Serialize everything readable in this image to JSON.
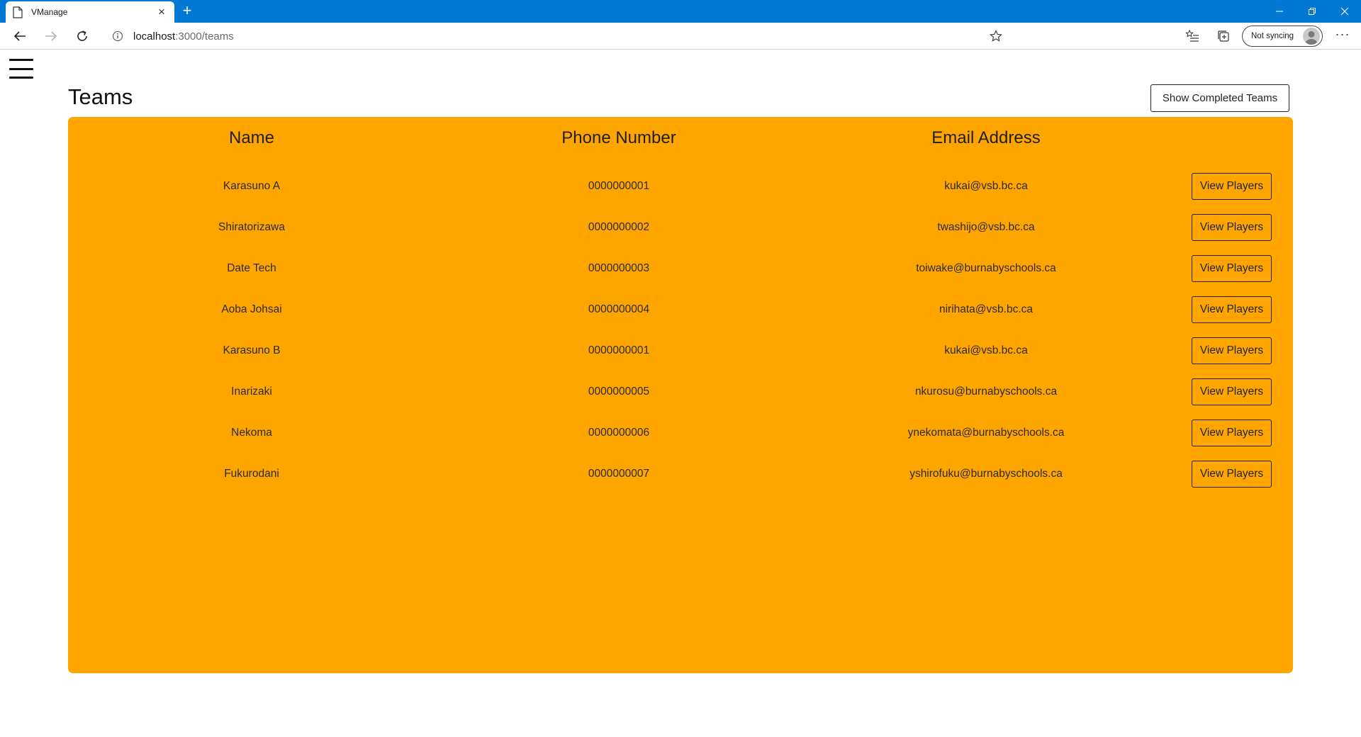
{
  "browser": {
    "tab_title": "VManage",
    "url_host": "localhost",
    "url_path": ":3000/teams",
    "sync_label": "Not syncing"
  },
  "page": {
    "title": "Teams",
    "show_completed_label": "Show Completed Teams"
  },
  "table": {
    "headers": {
      "name": "Name",
      "phone": "Phone Number",
      "email": "Email Address"
    },
    "action_label": "View Players",
    "rows": [
      {
        "name": "Karasuno A",
        "phone": "0000000001",
        "email": "kukai@vsb.bc.ca"
      },
      {
        "name": "Shiratorizawa",
        "phone": "0000000002",
        "email": "twashijo@vsb.bc.ca"
      },
      {
        "name": "Date Tech",
        "phone": "0000000003",
        "email": "toiwake@burnabyschools.ca"
      },
      {
        "name": "Aoba Johsai",
        "phone": "0000000004",
        "email": "nirihata@vsb.bc.ca"
      },
      {
        "name": "Karasuno B",
        "phone": "0000000001",
        "email": "kukai@vsb.bc.ca"
      },
      {
        "name": "Inarizaki",
        "phone": "0000000005",
        "email": "nkurosu@burnabyschools.ca"
      },
      {
        "name": "Nekoma",
        "phone": "0000000006",
        "email": "ynekomata@burnabyschools.ca"
      },
      {
        "name": "Fukurodani",
        "phone": "0000000007",
        "email": "yshirofuku@burnabyschools.ca"
      }
    ]
  },
  "colors": {
    "titlebar": "#0078d4",
    "table_background": "#ffa500"
  }
}
